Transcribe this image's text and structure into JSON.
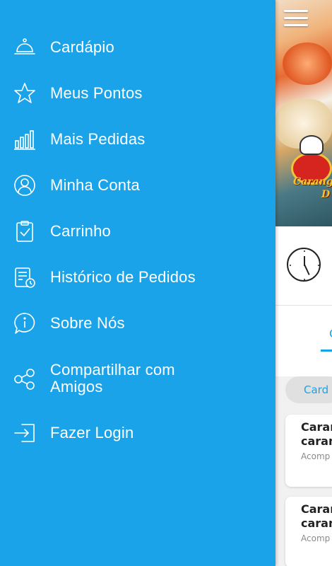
{
  "drawer": {
    "background": "#1aa3e8",
    "items": [
      {
        "label": "Cardápio",
        "icon": "cloche-icon"
      },
      {
        "label": "Meus Pontos",
        "icon": "star-icon"
      },
      {
        "label": "Mais Pedidas",
        "icon": "bar-chart-icon"
      },
      {
        "label": "Minha Conta",
        "icon": "user-circle-icon"
      },
      {
        "label": "Carrinho",
        "icon": "clipboard-check-icon"
      },
      {
        "label": "Histórico de Pedidos",
        "icon": "order-history-icon"
      },
      {
        "label": "Sobre Nós",
        "icon": "info-bubble-icon"
      },
      {
        "label": "Compartilhar com Amigos",
        "label_line1": "Compartilhar com",
        "label_line2": "Amigos",
        "icon": "share-icon"
      },
      {
        "label": "Fazer Login",
        "icon": "login-icon"
      }
    ]
  },
  "background_app": {
    "brand_line1": "Carang",
    "brand_line2": "D",
    "category_tab": "C",
    "category_chip": "Card",
    "cards": [
      {
        "title_line1": "Caran",
        "title_line2": "caran",
        "subtitle": "Acomp"
      },
      {
        "title_line1": "Caran",
        "title_line2": "caran",
        "subtitle": "Acomp"
      }
    ],
    "accent_color": "#1aa3e8"
  }
}
